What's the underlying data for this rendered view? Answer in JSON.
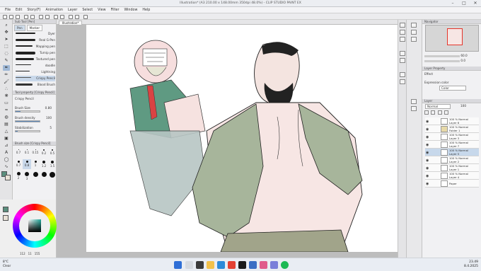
{
  "window": {
    "title": "Illustration* (A3 210.00 x 148.00mm 350dpi 48.0%) - CLIP STUDIO PAINT EX",
    "minimize": "–",
    "maximize": "□",
    "close": "✕"
  },
  "menu": [
    "File",
    "Edit",
    "Story(F)",
    "Animation",
    "Layer",
    "Select",
    "View",
    "Filter",
    "Window",
    "Help"
  ],
  "document_tab": "Illustration*",
  "subtool": {
    "header": "Sub Tool [Pen]",
    "tabs": [
      "Pen",
      "Marker"
    ],
    "brushes": [
      "Dyer",
      "Real G-Pen",
      "Mapping pen",
      "Turnip pen",
      "Textured pen",
      "doodle",
      "Lightning",
      "Crispy Pencil",
      "Blood Brush"
    ],
    "selected_brush": "Crispy Pencil"
  },
  "tool_property": {
    "header": "Tool property [Crispy Pencil]",
    "brush_name": "Crispy Pencil",
    "brush_size_label": "Brush Size",
    "brush_size_value": "0.80",
    "brush_density_label": "Brush density",
    "brush_density_value": "100",
    "stabilization_label": "Stabilization",
    "stabilization_value": "5"
  },
  "brush_size_panel": {
    "header": "Brush size [Crispy Pencil]",
    "sizes": [
      "0.7",
      "0.1",
      "0.15",
      "0.2",
      "0.5",
      "0.7",
      "0.8",
      "1",
      "1.2",
      "1.5",
      "2",
      "3"
    ],
    "selected": "0.8"
  },
  "color": {
    "h": "112",
    "s": "11",
    "v": "155",
    "main": "#5b8f7d",
    "sub": "#e9e2d6"
  },
  "navigator": {
    "header": "Navigator",
    "zoom": "60.0",
    "rotation": "0.0"
  },
  "layer_property": {
    "header": "Layer Property",
    "effect_label": "Effect",
    "expression_label": "Expression color",
    "expression_value": "Color"
  },
  "layers": {
    "header": "Layer",
    "blend": "Normal",
    "opacity": "100",
    "items": [
      {
        "pct": "100 % Normal",
        "name": "Layer 6"
      },
      {
        "pct": "100 % Normal",
        "name": "Folder 1"
      },
      {
        "pct": "100 % Normal",
        "name": "Layer 3"
      },
      {
        "pct": "100 % Normal",
        "name": "Layer 7"
      },
      {
        "pct": "100 % Normal",
        "name": "Layer 5"
      },
      {
        "pct": "100 % Normal",
        "name": "Layer 2"
      },
      {
        "pct": "100 % Normal",
        "name": "Layer 1"
      },
      {
        "pct": "100 % Normal",
        "name": "Layer 4"
      },
      {
        "pct": "",
        "name": "Paper"
      }
    ],
    "selected_index": 4
  },
  "taskbar": {
    "weather_temp": "8°C",
    "weather_desc": "Clear",
    "time": "23.49",
    "date": "8.4.2025"
  }
}
